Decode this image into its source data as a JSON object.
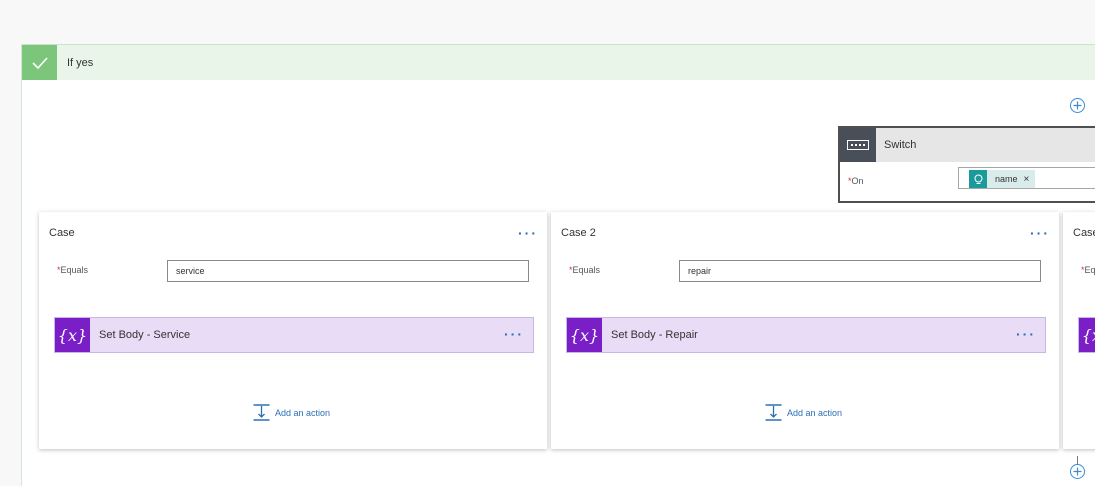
{
  "condition": {
    "label": "If yes",
    "accent_color": "#7cc67c"
  },
  "switch": {
    "title": "Switch",
    "on_label": "On",
    "required_mark": "*",
    "token": {
      "text": "name",
      "remove": "×",
      "icon": "dynamic-content-icon"
    }
  },
  "cases": [
    {
      "title": "Case",
      "equals_label": "Equals",
      "equals_value": "service",
      "action_title": "Set Body - Service",
      "action_icon_glyph": "{x}",
      "add_action_label": "Add an action"
    },
    {
      "title": "Case 2",
      "equals_label": "Equals",
      "equals_value": "repair",
      "action_title": "Set Body - Repair",
      "action_icon_glyph": "{x}",
      "add_action_label": "Add an action"
    },
    {
      "title": "Case",
      "equals_label": "Eq",
      "action_icon_glyph": "{x}"
    }
  ],
  "menu_glyph": "···",
  "colors": {
    "variable_purple": "#7a1fc7",
    "variable_row": "#e9dcf6",
    "link_blue": "#2a6fb5",
    "switch_dark": "#484f58"
  }
}
